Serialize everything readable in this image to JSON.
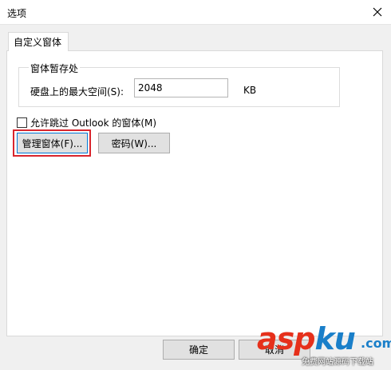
{
  "window": {
    "title": "选项"
  },
  "tabs": [
    {
      "label": "自定义窗体"
    }
  ],
  "group": {
    "legend": "窗体暂存处",
    "max_space_label": "硬盘上的最大空间(S):",
    "max_space_value": "2048",
    "unit": "KB"
  },
  "allow_skip": {
    "label": "允许跳过 Outlook 的窗体(M)",
    "checked": false
  },
  "buttons": {
    "manage": "管理窗体(F)...",
    "password": "密码(W)..."
  },
  "footer": {
    "ok": "确定",
    "cancel": "取消"
  },
  "watermark": {
    "brand_a": "asp",
    "brand_b": "ku",
    "suffix": ".com",
    "tagline": "免费网站源码下载站"
  },
  "colors": {
    "highlight": "#d9252d",
    "focus": "#0078d7"
  }
}
